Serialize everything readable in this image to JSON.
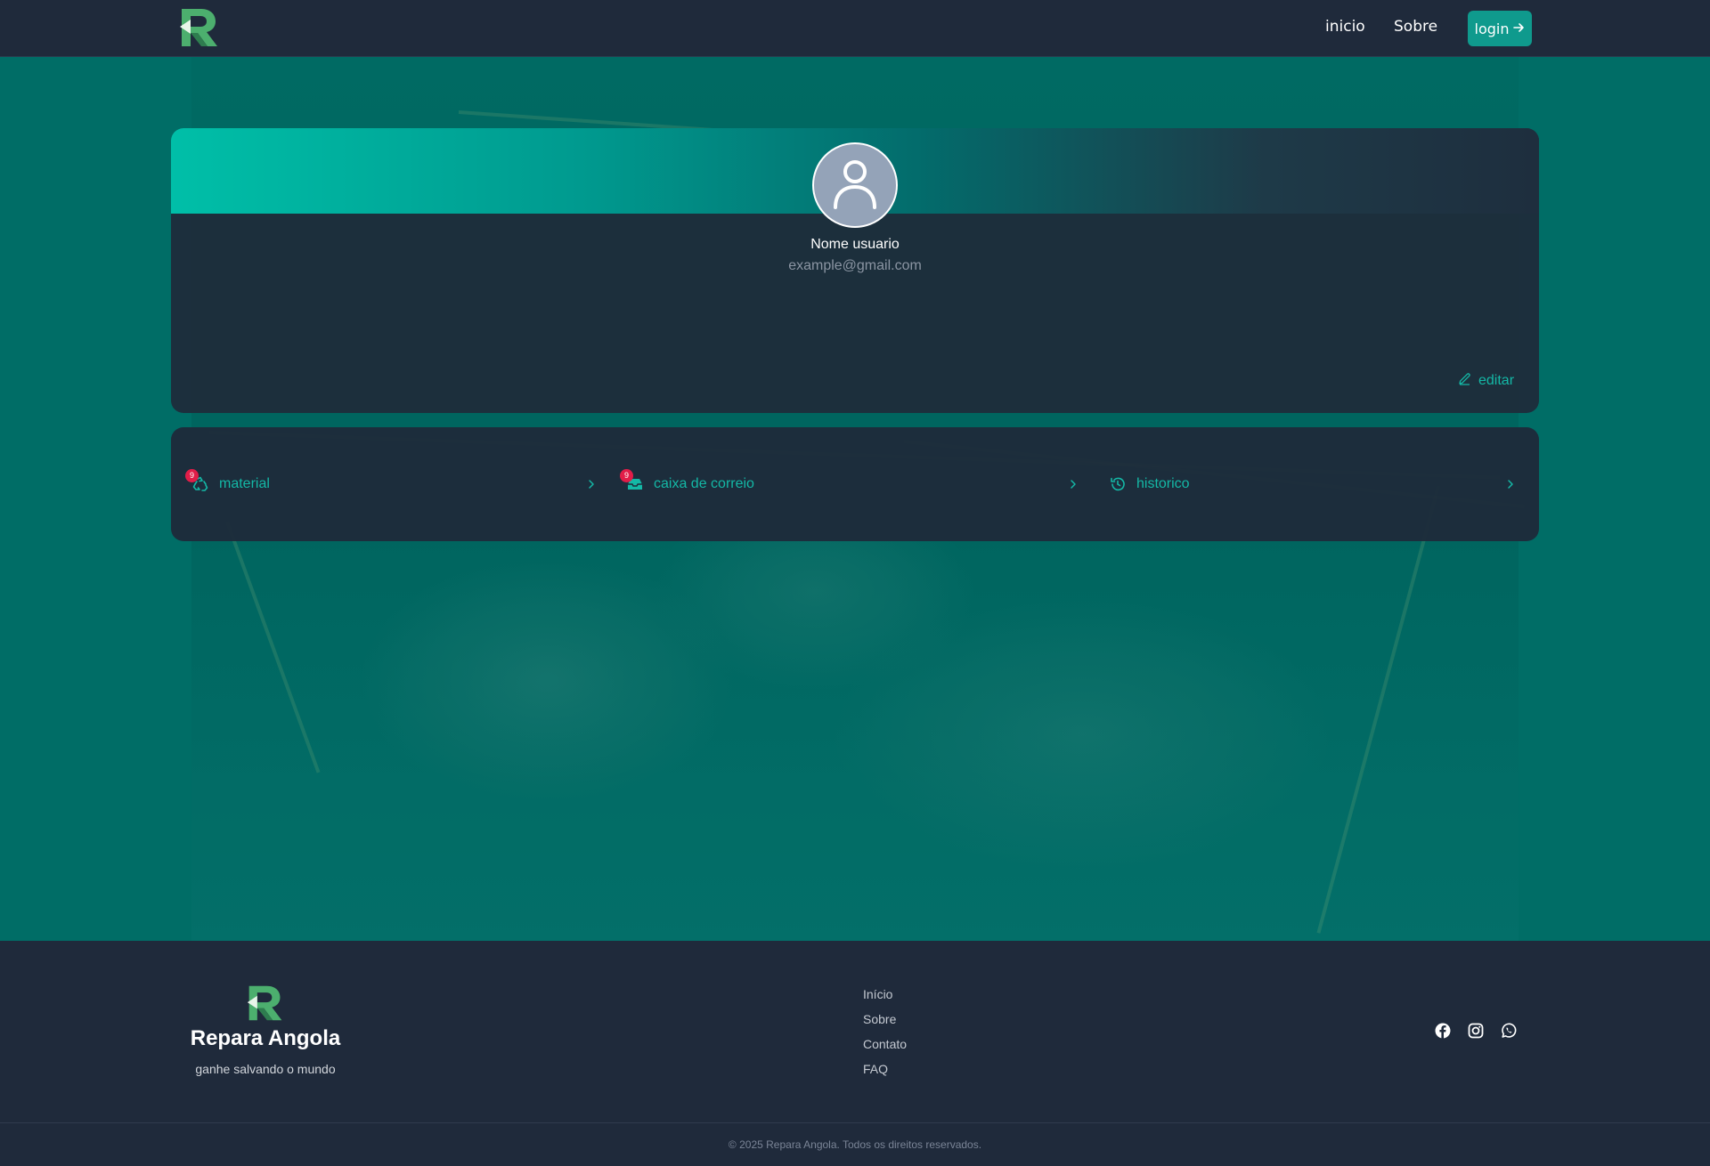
{
  "header": {
    "logo_icon": "repara-r-logo-icon",
    "nav": [
      {
        "label": "inicio"
      },
      {
        "label": "Sobre"
      }
    ],
    "login_label": "login",
    "login_icon": "arrow-right-icon",
    "accent_color": "#0f9a8d"
  },
  "profile": {
    "avatar_icon": "user-icon",
    "name": "Nome usuario",
    "email": "example@gmail.com",
    "edit_label": "editar",
    "edit_icon": "pencil-icon"
  },
  "menu": {
    "items": [
      {
        "label": "material",
        "icon": "recycle-icon",
        "badge": "9"
      },
      {
        "label": "caixa de correio",
        "icon": "inbox-icon",
        "badge": "9"
      },
      {
        "label": "historico",
        "icon": "history-icon"
      }
    ],
    "chevron_icon": "chevron-right-icon",
    "item_color": "#14b8a6",
    "badge_color": "#e11d48"
  },
  "footer": {
    "brand": "Repara Angola",
    "tagline": "ganhe salvando o mundo",
    "links": [
      {
        "label": "Início"
      },
      {
        "label": "Sobre"
      },
      {
        "label": "Contato"
      },
      {
        "label": "FAQ"
      }
    ],
    "social": [
      "facebook-icon",
      "instagram-icon",
      "whatsapp-icon"
    ],
    "copyright": "© 2025 Repara Angola. Todos os direitos reservados."
  },
  "colors": {
    "background_dark": "#1f2a3b",
    "hero_teal": "#006d66"
  }
}
